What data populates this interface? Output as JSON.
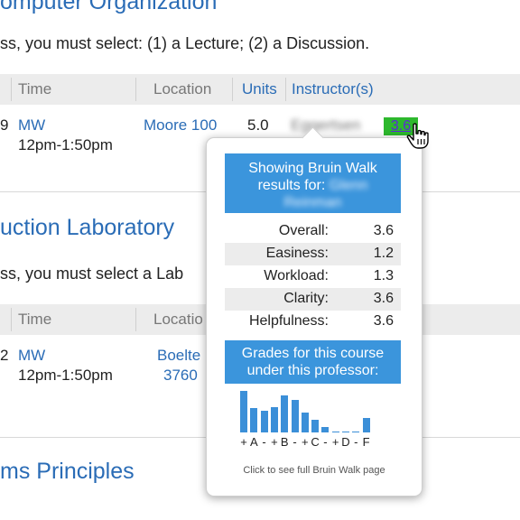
{
  "sections": [
    {
      "title": "omputer Organization",
      "requirement": "ss, you must select: (1) a Lecture; (2) a Discussion.",
      "headers": {
        "time": "Time",
        "location": "Location",
        "units": "Units",
        "instructor": "Instructor(s)"
      },
      "row": {
        "num": "9",
        "days": "MW",
        "time": "12pm-1:50pm",
        "location": "Moore 100",
        "units": "5.0",
        "instructor": "Eggertsen",
        "rating": "3.6"
      }
    },
    {
      "title": "uction Laboratory",
      "requirement": "ss, you must select a Lab",
      "headers": {
        "time": "Time",
        "location": "Locatio"
      },
      "row": {
        "num": "2",
        "days": "MW",
        "time": "12pm-1:50pm",
        "location_line1": "Boelte",
        "location_line2": "3760"
      }
    },
    {
      "title": "ms Principles"
    }
  ],
  "popup": {
    "header_line1": "Showing Bruin Walk",
    "header_line2": "results for:",
    "prof_name_blur": "Glenn",
    "prof_name_blur2": "Reinman",
    "ratings": [
      {
        "label": "Overall:",
        "value": "3.6"
      },
      {
        "label": "Easiness:",
        "value": "1.2"
      },
      {
        "label": "Workload:",
        "value": "1.3"
      },
      {
        "label": "Clarity:",
        "value": "3.6"
      },
      {
        "label": "Helpfulness:",
        "value": "3.6"
      }
    ],
    "grades_header_line1": "Grades for this course",
    "grades_header_line2": "under this professor:",
    "grade_labels": [
      "+",
      "A",
      "-",
      "+",
      "B",
      "-",
      "+",
      "C",
      "-",
      "+",
      "D",
      "-",
      "F"
    ],
    "grade_distribution": [
      1.0,
      0.58,
      0.52,
      0.6,
      0.9,
      0.78,
      0.48,
      0.3,
      0.14,
      0.02,
      0.02,
      0.02,
      0.34
    ],
    "footer": "Click to see full Bruin Walk page"
  },
  "colors": {
    "link": "#2a6cb6",
    "badge": "#2db82d",
    "popup_blue": "#3b95dc",
    "bar": "#3b8fd8"
  }
}
